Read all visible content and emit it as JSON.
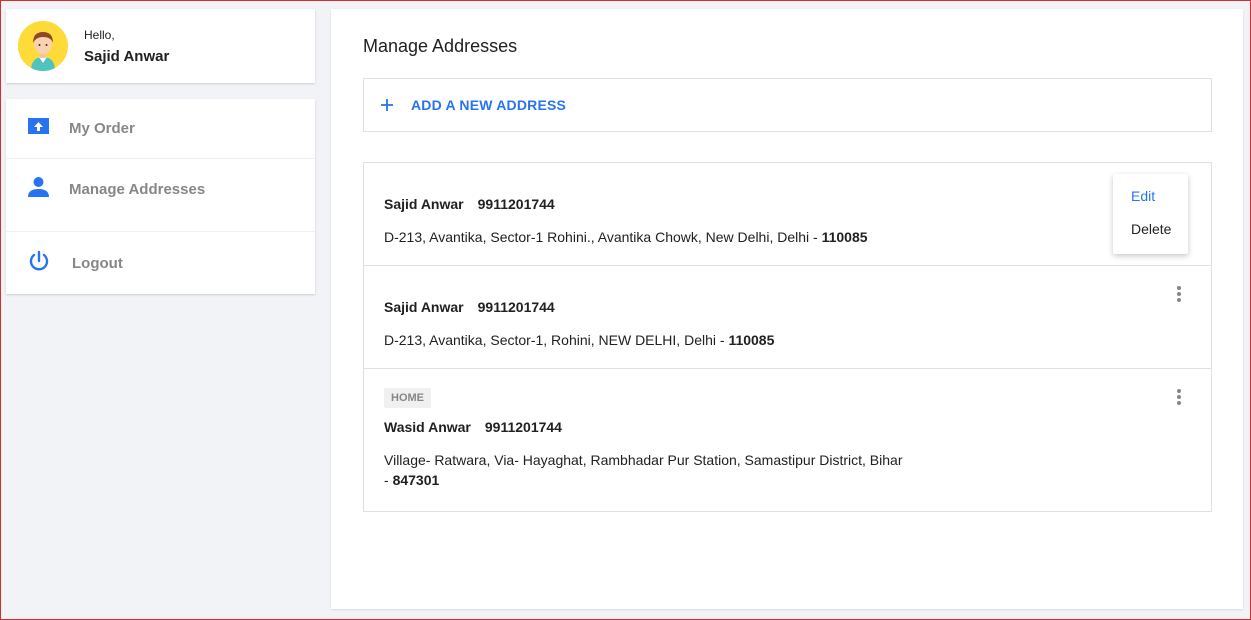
{
  "profile": {
    "greeting": "Hello,",
    "name": "Sajid Anwar",
    "avatar_icon": "user-avatar-icon"
  },
  "nav": {
    "items": [
      {
        "label": "My Order",
        "icon": "orders-icon"
      },
      {
        "label": "Manage Addresses",
        "icon": "user-icon"
      },
      {
        "label": "Logout",
        "icon": "power-icon"
      }
    ]
  },
  "main": {
    "title": "Manage Addresses",
    "add_label": "ADD A NEW ADDRESS",
    "add_icon": "plus-icon"
  },
  "addresses": [
    {
      "name": "Sajid Anwar",
      "phone": "9911201744",
      "address": "D-213, Avantika, Sector-1 Rohini., Avantika Chowk, New Delhi, Delhi - ",
      "pincode": "110085",
      "menu": {
        "edit": "Edit",
        "delete": "Delete"
      }
    },
    {
      "name": "Sajid Anwar",
      "phone": "9911201744",
      "address": "D-213, Avantika, Sector-1, Rohini, NEW DELHI, Delhi - ",
      "pincode": "110085"
    },
    {
      "tag": "HOME",
      "name": "Wasid Anwar",
      "phone": "9911201744",
      "address": "Village- Ratwara, Via- Hayaghat, Rambhadar Pur Station, Samastipur District, Bihar - ",
      "pincode": "847301"
    }
  ],
  "colors": {
    "accent": "#2874f0",
    "muted": "#878787",
    "background": "#f1f3f6"
  }
}
